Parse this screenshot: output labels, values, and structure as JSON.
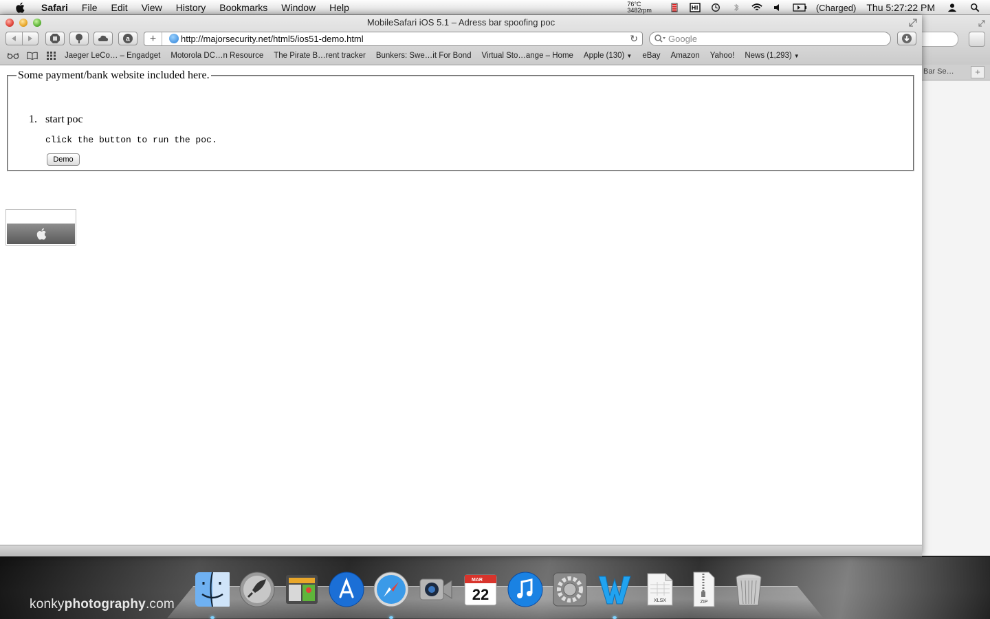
{
  "menubar": {
    "app_name": "Safari",
    "items": [
      "File",
      "Edit",
      "View",
      "History",
      "Bookmarks",
      "Window",
      "Help"
    ],
    "temperature": "76°C",
    "fan_speed": "3482rpm",
    "battery_status": "(Charged)",
    "clock": "Thu 5:27:22 PM"
  },
  "window": {
    "title": "MobileSafari iOS 5.1 – Adress bar spoofing poc",
    "address_url": "http://majorsecurity.net/html5/ios51-demo.html",
    "search_placeholder": "Google",
    "bookmarks": [
      {
        "label": "Jaeger LeCo… – Engadget"
      },
      {
        "label": "Motorola DC…n Resource"
      },
      {
        "label": "The Pirate B…rent tracker"
      },
      {
        "label": "Bunkers: Swe…it For Bond"
      },
      {
        "label": "Virtual Sto…ange – Home"
      },
      {
        "label": "Apple (130)",
        "menu": true
      },
      {
        "label": "eBay"
      },
      {
        "label": "Amazon"
      },
      {
        "label": "Yahoo!"
      },
      {
        "label": "News (1,293)",
        "menu": true
      }
    ]
  },
  "background_window": {
    "tab_label": "Bar Se…"
  },
  "page": {
    "legend": "Some payment/bank website included here.",
    "list_number": "1.",
    "list_item": "start poc",
    "instruction": "click the button to run the poc.",
    "demo_button": "Demo"
  },
  "dock": {
    "items": [
      {
        "name": "finder",
        "running": true
      },
      {
        "name": "launchpad",
        "running": false
      },
      {
        "name": "preview",
        "running": false
      },
      {
        "name": "app-store",
        "running": false
      },
      {
        "name": "safari",
        "running": true
      },
      {
        "name": "facetime",
        "running": false
      },
      {
        "name": "calendar",
        "running": false
      },
      {
        "name": "itunes",
        "running": false
      },
      {
        "name": "system-preferences",
        "running": false
      },
      {
        "name": "word",
        "running": true
      },
      {
        "name": "xlsx-document",
        "running": false
      },
      {
        "name": "zip-archive",
        "running": false
      },
      {
        "name": "trash",
        "running": false
      }
    ],
    "calendar_month": "MAR",
    "calendar_day": "22",
    "xlsx_label": "XLSX",
    "zip_label": "ZIP"
  },
  "desktop": {
    "watermark_light": "konky",
    "watermark_bold": "photography",
    "watermark_suffix": ".com"
  },
  "colors": {
    "accent_blue": "#2a7ed6",
    "close_red": "#e0443a",
    "minimize_yellow": "#e9a72a",
    "zoom_green": "#5fb53a"
  }
}
